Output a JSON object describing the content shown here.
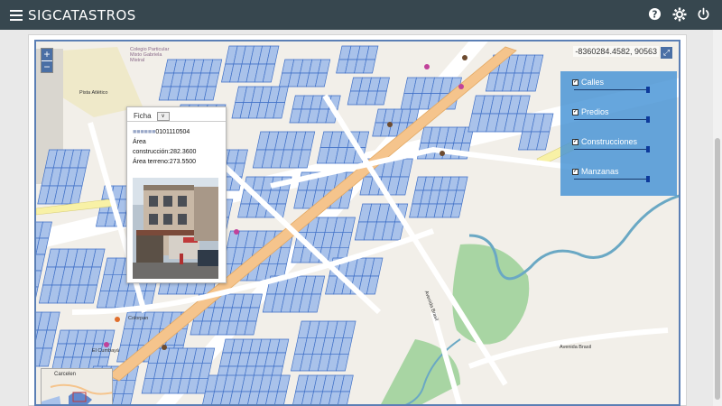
{
  "header": {
    "title": "SIGCATASTROS",
    "icons": [
      "menu-icon",
      "help-icon",
      "gear-icon",
      "power-icon"
    ]
  },
  "map": {
    "coordinates": "-8360284.4582, 90563",
    "zoom_in_label": "+",
    "zoom_out_label": "−",
    "labels": {
      "park": "Pista Atlético",
      "colegio_top": "Colegio Particular Mixto Gabriela Mistral",
      "avenida_brasil_1": "Avenida Brasil",
      "avenida_brasil_2": "Avenida Brasil",
      "colorpan": "Colorpan",
      "cumbaya": "El Cumbayá",
      "minimap_label": "Carcelen"
    }
  },
  "layers": {
    "items": [
      {
        "label": "Calles",
        "checked": true,
        "opacity": 1.0
      },
      {
        "label": "Predios",
        "checked": true,
        "opacity": 1.0
      },
      {
        "label": "Construcciones",
        "checked": true,
        "opacity": 1.0
      },
      {
        "label": "Manzanas",
        "checked": true,
        "opacity": 1.0
      }
    ]
  },
  "popup": {
    "select_label": "Ficha",
    "clave": "0101110504",
    "area_label": "Área",
    "construccion": "construcción:282.3600",
    "terreno": "Área terreno:273.5500"
  },
  "colors": {
    "topbar": "#37474f",
    "parcel_fill": "#a9c2ea",
    "parcel_stroke": "#3e6fc6",
    "layer_panel": "#4493d6",
    "road_main": "#f5c48c",
    "park": "#a8d5a3",
    "river": "#6aa8c4"
  }
}
